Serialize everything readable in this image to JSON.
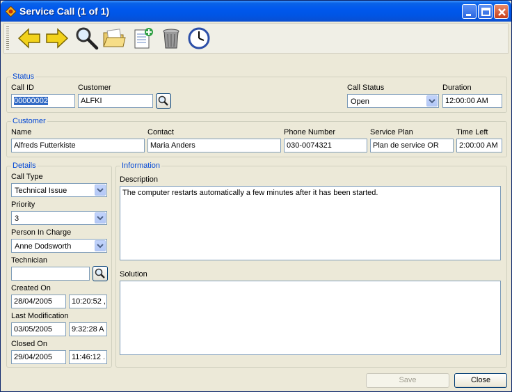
{
  "window": {
    "title": "Service Call (1 of 1)"
  },
  "toolbar": {
    "tools": [
      {
        "name": "back-arrow-icon"
      },
      {
        "name": "forward-arrow-icon"
      },
      {
        "name": "search-icon"
      },
      {
        "name": "open-folder-icon"
      },
      {
        "name": "new-document-icon"
      },
      {
        "name": "trash-icon"
      },
      {
        "name": "clock-icon"
      }
    ]
  },
  "status": {
    "legend": "Status",
    "call_id_label": "Call ID",
    "call_id": "00000002",
    "customer_label": "Customer",
    "customer": "ALFKI",
    "call_status_label": "Call Status",
    "call_status": "Open",
    "duration_label": "Duration",
    "duration": "12:00:00 AM"
  },
  "customer": {
    "legend": "Customer",
    "name_label": "Name",
    "name": "Alfreds Futterkiste",
    "contact_label": "Contact",
    "contact": "Maria Anders",
    "phone_label": "Phone Number",
    "phone": "030-0074321",
    "plan_label": "Service Plan",
    "plan": "Plan de service OR",
    "time_left_label": "Time Left",
    "time_left": "2:00:00 AM"
  },
  "details": {
    "legend": "Details",
    "call_type_label": "Call Type",
    "call_type": "Technical Issue",
    "priority_label": "Priority",
    "priority": "3",
    "person_label": "Person In Charge",
    "person": "Anne Dodsworth",
    "technician_label": "Technician",
    "technician": "",
    "created_label": "Created On",
    "created_date": "28/04/2005",
    "created_time": "10:20:52 ,",
    "modified_label": "Last Modification",
    "modified_date": "03/05/2005",
    "modified_time": "9:32:28 A",
    "closed_label": "Closed On",
    "closed_date": "29/04/2005",
    "closed_time": "11:46:12 ."
  },
  "information": {
    "legend": "Information",
    "description_label": "Description",
    "description": "The computer restarts automatically a few minutes after it has been started.",
    "solution_label": "Solution",
    "solution": ""
  },
  "footer": {
    "save_label": "Save",
    "close_label": "Close"
  }
}
